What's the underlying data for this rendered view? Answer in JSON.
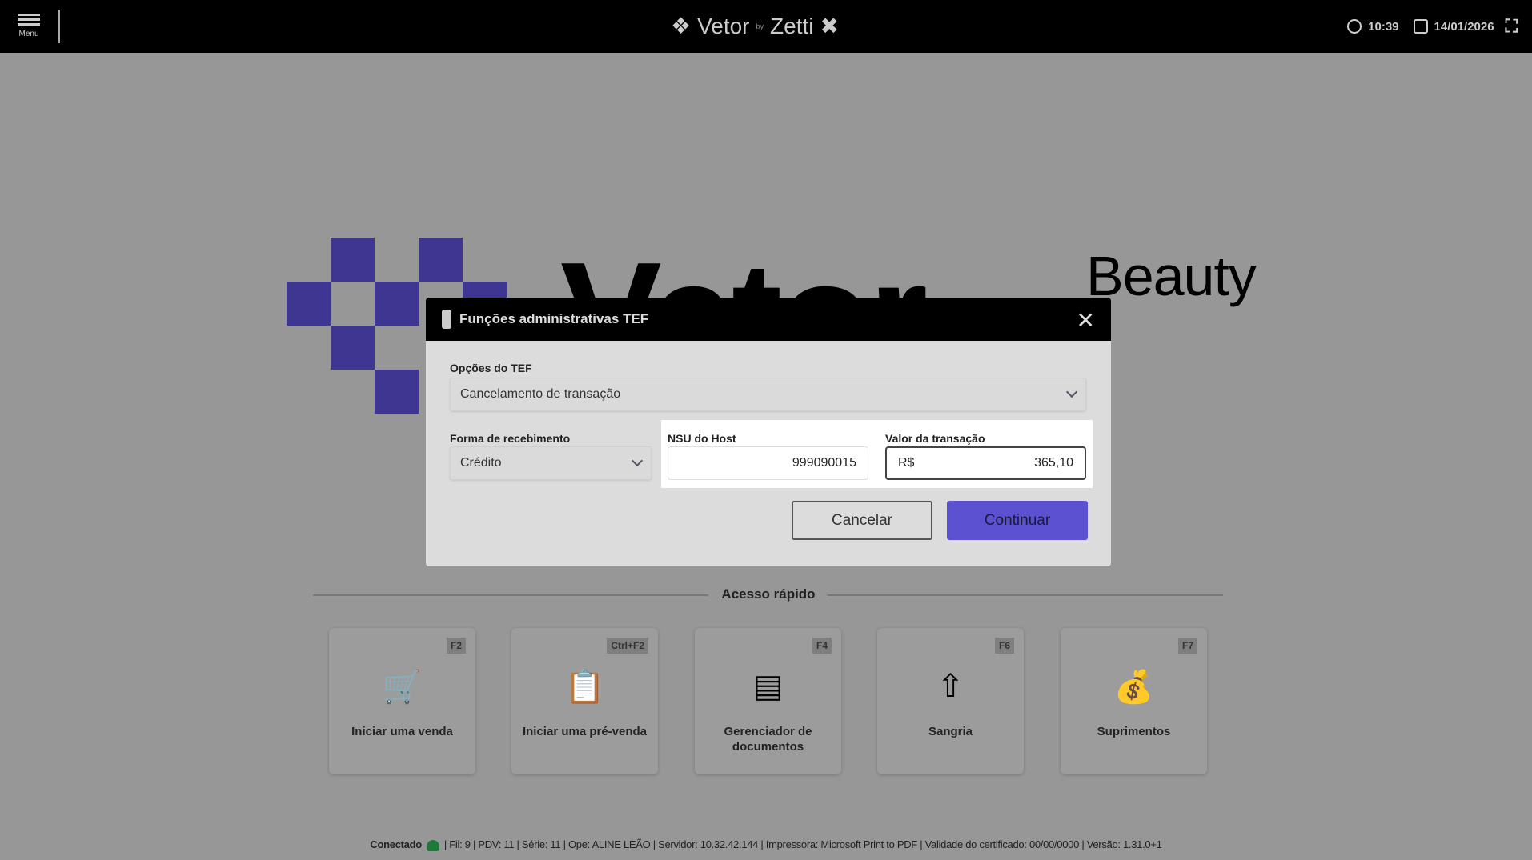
{
  "header": {
    "menu_label": "Menu",
    "brand_left": "Vetor",
    "brand_by": "by",
    "brand_right": "Zetti",
    "time": "10:39",
    "date": "14/01/2026"
  },
  "background": {
    "logo_word": "Vetor",
    "logo_suffix": "Beauty"
  },
  "dialog": {
    "title": "Funções administrativas TEF",
    "tef_options_label": "Opções do TEF",
    "tef_option_value": "Cancelamento de transação",
    "payment_label": "Forma de recebimento",
    "payment_value": "Crédito",
    "nsu_label": "NSU do Host",
    "nsu_value": "999090015",
    "amount_label": "Valor da transação",
    "currency": "R$",
    "amount_value": "365,10",
    "cancel": "Cancelar",
    "continue": "Continuar"
  },
  "quick_access": {
    "title": "Acesso rápido",
    "items": [
      {
        "key": "F2",
        "label": "Iniciar uma venda",
        "icon": "cart-icon"
      },
      {
        "key": "Ctrl+F2",
        "label": "Iniciar uma pré-venda",
        "icon": "clipboard-cart-icon"
      },
      {
        "key": "F4",
        "label": "Gerenciador de documentos",
        "icon": "document-tray-icon"
      },
      {
        "key": "F6",
        "label": "Sangria",
        "icon": "money-out-icon"
      },
      {
        "key": "F7",
        "label": "Suprimentos",
        "icon": "money-bag-icon"
      }
    ]
  },
  "footer": {
    "status": "Conectado",
    "info": "| Fil: 9 | PDV: 11 | Série: 11 | Ope: ALINE LEÃO | Servidor: 10.32.42.144 | Impressora: Microsoft Print to PDF | Validade do certificado: 00/00/0000 | Versão: 1.31.0+1"
  }
}
